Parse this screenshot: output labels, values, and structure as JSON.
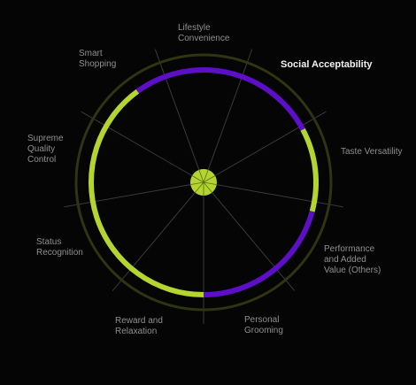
{
  "segments": [
    {
      "label": "Lifestyle\nConvenience"
    },
    {
      "label": "Social Acceptability",
      "active": true
    },
    {
      "label": "Taste Versatility"
    },
    {
      "label": "Performance\nand Added\nValue (Others)"
    },
    {
      "label": "Personal\nGrooming"
    },
    {
      "label": "Reward and\nRelaxation"
    },
    {
      "label": "Status\nRecognition"
    },
    {
      "label": "Supreme\nQuality\nControl"
    },
    {
      "label": "Smart\nShopping"
    }
  ],
  "arcs": [
    {
      "name": "arc-purple-top",
      "start_deg": -36,
      "end_deg": 62,
      "color": "#5c0fc7"
    },
    {
      "name": "arc-green-right",
      "start_deg": 62,
      "end_deg": 105,
      "color": "#b4d430"
    },
    {
      "name": "arc-purple-bottom-right",
      "start_deg": 105,
      "end_deg": 180,
      "color": "#5c0fc7"
    },
    {
      "name": "arc-green-left",
      "start_deg": 180,
      "end_deg": 324,
      "color": "#b4d430"
    }
  ],
  "colors": {
    "background": "#050505",
    "outer_ring": "#2d3512",
    "spoke": "#3a3a3a",
    "center": "#b4d430"
  }
}
